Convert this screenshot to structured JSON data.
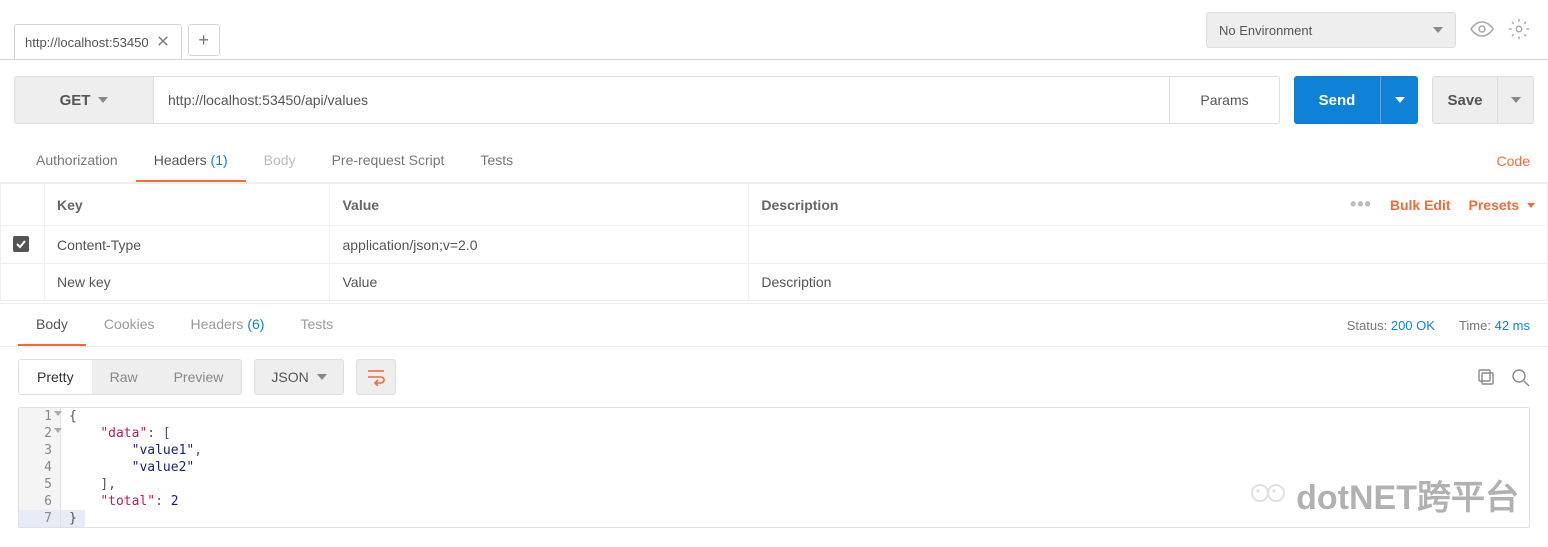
{
  "env": {
    "selected": "No Environment"
  },
  "tab": {
    "title": "http://localhost:53450"
  },
  "request": {
    "method": "GET",
    "url": "http://localhost:53450/api/values",
    "params_label": "Params",
    "send_label": "Send",
    "save_label": "Save"
  },
  "subtabs": {
    "authorization": "Authorization",
    "headers": "Headers",
    "headers_count": "(1)",
    "body": "Body",
    "prerequest": "Pre-request Script",
    "tests": "Tests",
    "code": "Code"
  },
  "headers_table": {
    "cols": {
      "key": "Key",
      "value": "Value",
      "description": "Description"
    },
    "actions": {
      "bulk": "Bulk Edit",
      "presets": "Presets"
    },
    "rows": [
      {
        "checked": true,
        "key": "Content-Type",
        "value": "application/json;v=2.0",
        "description": ""
      }
    ],
    "empty": {
      "key": "New key",
      "value": "Value",
      "description": "Description"
    }
  },
  "response": {
    "tabs": {
      "body": "Body",
      "cookies": "Cookies",
      "headers": "Headers",
      "headers_count": "(6)",
      "tests": "Tests"
    },
    "status_label": "Status:",
    "status_value": "200 OK",
    "time_label": "Time:",
    "time_value": "42 ms",
    "fmt": {
      "pretty": "Pretty",
      "raw": "Raw",
      "preview": "Preview",
      "json": "JSON"
    },
    "json_lines": [
      {
        "n": "1",
        "fold": true,
        "html": "<span class='p'>{</span>"
      },
      {
        "n": "2",
        "fold": true,
        "html": "    <span class='k'>\"data\"</span><span class='p'>: [</span>"
      },
      {
        "n": "3",
        "html": "        <span class='s'>\"value1\"</span><span class='p'>,</span>"
      },
      {
        "n": "4",
        "html": "        <span class='s'>\"value2\"</span>"
      },
      {
        "n": "5",
        "html": "    <span class='p'>],</span>"
      },
      {
        "n": "6",
        "html": "    <span class='k'>\"total\"</span><span class='p'>: </span><span class='n'>2</span>"
      },
      {
        "n": "7",
        "hl": true,
        "html": "<span class='p'>}</span>"
      }
    ]
  },
  "watermark": "dotNET跨平台"
}
